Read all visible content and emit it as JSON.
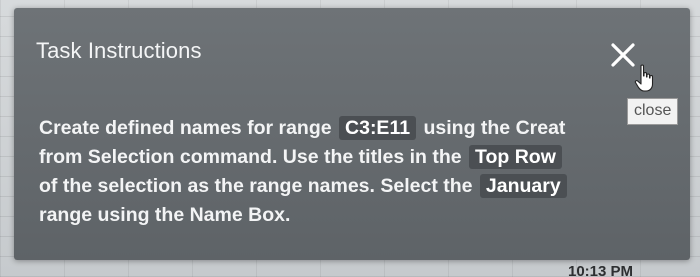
{
  "dialog": {
    "title": "Task Instructions",
    "close_tooltip": "close",
    "instruction": {
      "l1_a": "Create defined names for range",
      "l1_chip": "C3:E11",
      "l1_b": "using the Creat",
      "l2_a": "from Selection command. Use the titles in the",
      "l2_chip": "Top Row",
      "l3_a": "of the selection as the range names. Select the",
      "l3_chip": "January",
      "l4_a": "range using the Name Box."
    }
  },
  "taskbar": {
    "time": "10:13 PM"
  },
  "icons": {
    "close": "close-x-icon",
    "cursor": "hand-pointer-icon"
  },
  "colors": {
    "dialog_bg": "#676c70",
    "chip_bg": "#4b4f53",
    "text": "#f3f4f5"
  }
}
